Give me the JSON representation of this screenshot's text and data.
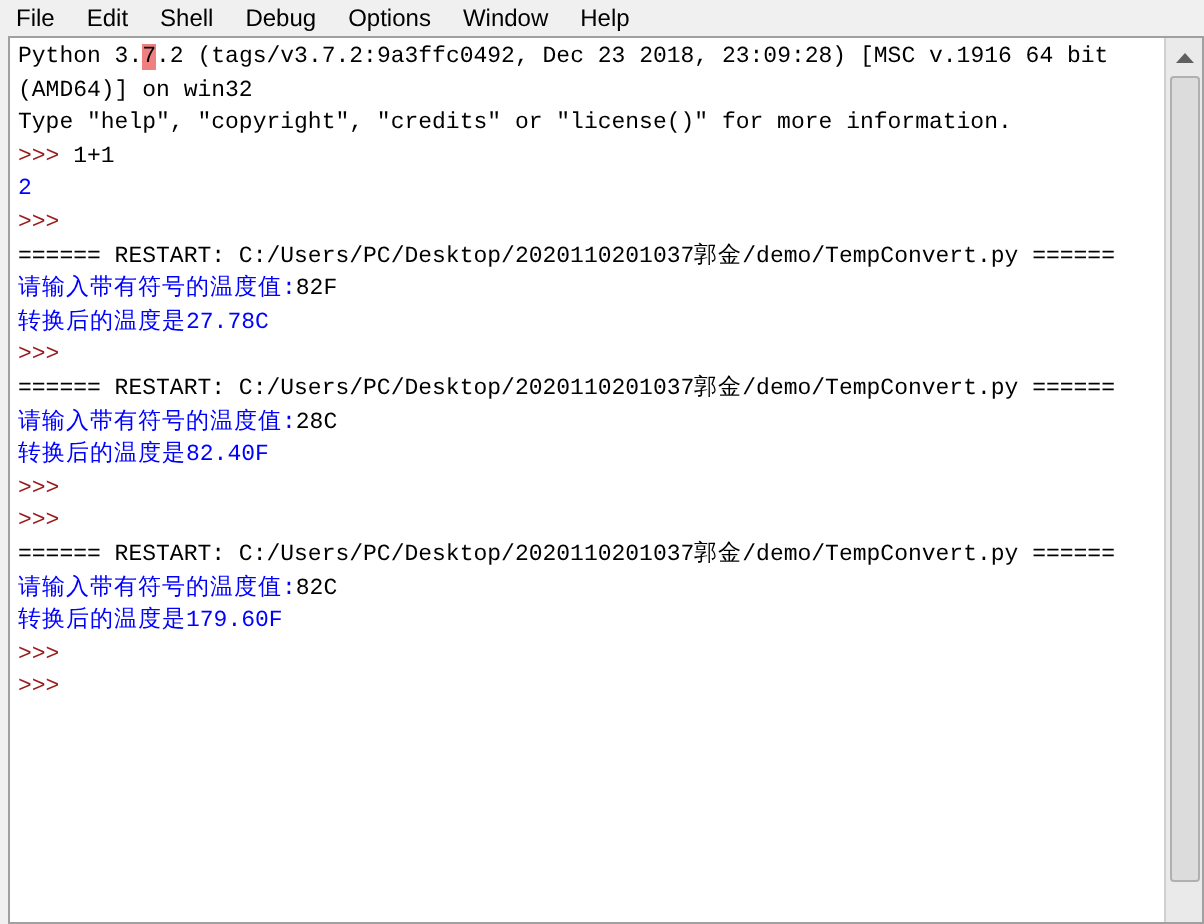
{
  "menu": [
    "File",
    "Edit",
    "Shell",
    "Debug",
    "Options",
    "Window",
    "Help"
  ],
  "lines": [
    [
      {
        "kind": "info",
        "text": "Python 3."
      },
      {
        "kind": "highlight",
        "text": "7"
      },
      {
        "kind": "info",
        "text": ".2 (tags/v3.7.2:9a3ffc0492, Dec 23 2018, 23:09:28) [MSC v.1916 64 bit"
      }
    ],
    [
      {
        "kind": "info",
        "text": "(AMD64)] on win32"
      }
    ],
    [
      {
        "kind": "info",
        "text": "Type \"help\", \"copyright\", \"credits\" or \"license()\" for more information."
      }
    ],
    [
      {
        "kind": "prompt",
        "text": ">>>"
      },
      {
        "kind": "input",
        "text": "1+1"
      }
    ],
    [
      {
        "kind": "output",
        "text": "2"
      }
    ],
    [
      {
        "kind": "prompt",
        "text": ">>>"
      }
    ],
    [
      {
        "kind": "info",
        "text": "====== RESTART: C:/Users/PC/Desktop/2020110201037郭金/demo/TempConvert.py ======"
      }
    ],
    [
      {
        "kind": "output",
        "text": "请输入带有符号的温度值:"
      },
      {
        "kind": "input",
        "text": "82F"
      }
    ],
    [
      {
        "kind": "output",
        "text": "转换后的温度是27.78C"
      }
    ],
    [
      {
        "kind": "prompt",
        "text": ">>>"
      }
    ],
    [
      {
        "kind": "info",
        "text": "====== RESTART: C:/Users/PC/Desktop/2020110201037郭金/demo/TempConvert.py ======"
      }
    ],
    [
      {
        "kind": "output",
        "text": "请输入带有符号的温度值:"
      },
      {
        "kind": "input",
        "text": "28C"
      }
    ],
    [
      {
        "kind": "output",
        "text": "转换后的温度是82.40F"
      }
    ],
    [
      {
        "kind": "prompt",
        "text": ">>>"
      }
    ],
    [
      {
        "kind": "prompt",
        "text": ">>>"
      }
    ],
    [
      {
        "kind": "info",
        "text": "====== RESTART: C:/Users/PC/Desktop/2020110201037郭金/demo/TempConvert.py ======"
      }
    ],
    [
      {
        "kind": "output",
        "text": "请输入带有符号的温度值:"
      },
      {
        "kind": "input",
        "text": "82C"
      }
    ],
    [
      {
        "kind": "output",
        "text": "转换后的温度是179.60F"
      }
    ],
    [
      {
        "kind": "prompt",
        "text": ">>>"
      }
    ],
    [
      {
        "kind": "prompt",
        "text": ">>>"
      }
    ]
  ]
}
